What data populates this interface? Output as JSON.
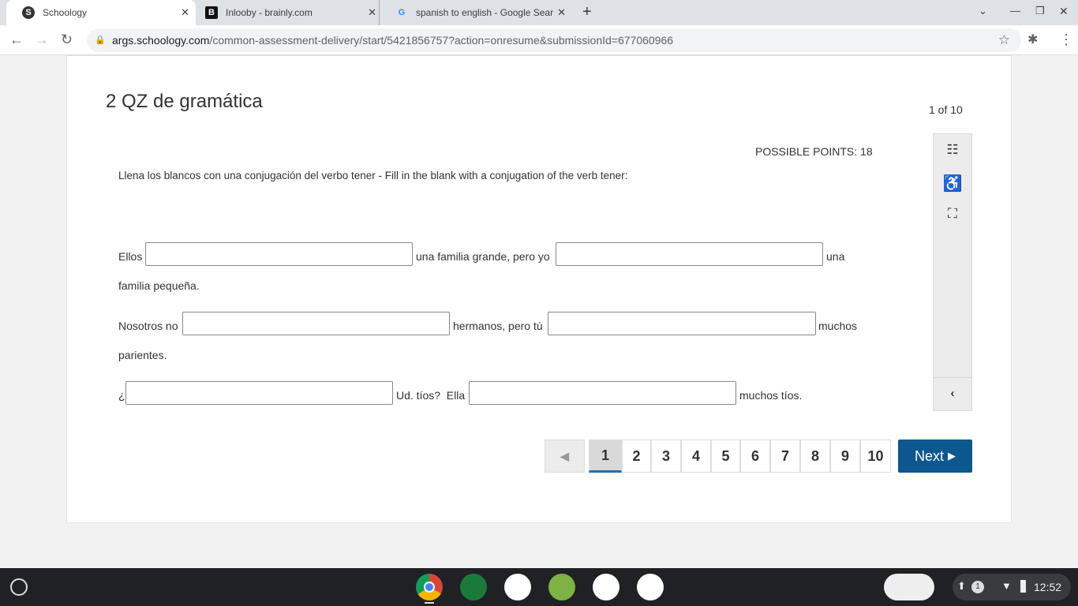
{
  "browser": {
    "tabs": [
      {
        "title": "Schoology",
        "icon": "S"
      },
      {
        "title": "Inlooby - brainly.com",
        "icon": "B"
      },
      {
        "title": "spanish to english - Google Sear",
        "icon": "G"
      }
    ],
    "url_host": "args.schoology.com",
    "url_path": "/common-assessment-delivery/start/5421856757?action=onresume&submissionId=677060966"
  },
  "quiz": {
    "title": "2 QZ de gramática",
    "progress": "1 of 10",
    "points": "POSSIBLE POINTS: 18",
    "instructions": "Llena los blancos con una conjugación del verbo tener - Fill in the blank with a conjugation of the verb tener:",
    "line1": {
      "a": "Ellos",
      "b": "una familia grande, pero yo",
      "c": "una",
      "d": "familia pequeña."
    },
    "line2": {
      "a": "Nosotros no",
      "b": "hermanos, pero tú",
      "c": "muchos",
      "d": "parientes."
    },
    "line3": {
      "a": "¿",
      "b": "Ud. tíos?  Ella",
      "c": "muchos tíos."
    }
  },
  "pagination": {
    "pages": [
      "1",
      "2",
      "3",
      "4",
      "5",
      "6",
      "7",
      "8",
      "9",
      "10"
    ],
    "current": "1",
    "next": "Next"
  },
  "system": {
    "time": "12:52",
    "notifications": "1"
  }
}
